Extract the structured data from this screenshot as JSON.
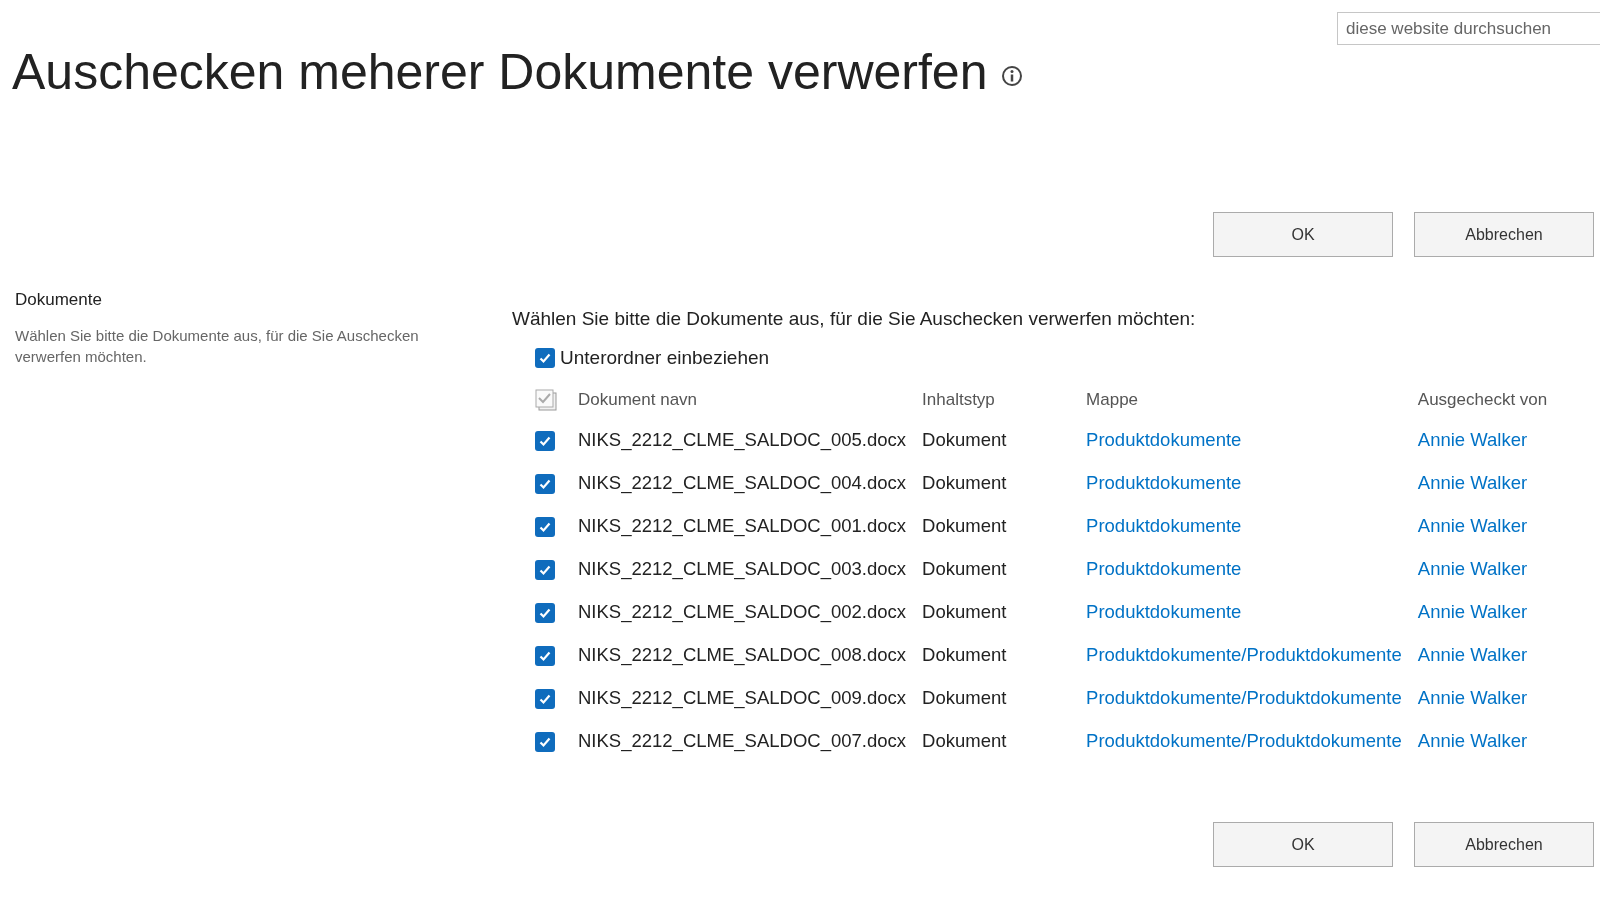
{
  "search": {
    "placeholder": "diese website durchsuchen"
  },
  "title": "Auschecken meherer Dokumente verwerfen",
  "top_buttons": [
    "OK",
    "Abbrechen"
  ],
  "section": {
    "label": "Dokumente",
    "description": "Wählen Sie bitte die Dokumente aus, für die Sie Auschecken verwerfen möchten."
  },
  "instruction": "Wählen Sie bitte die Dokumente aus, für die Sie Auschecken verwerfen möchten:",
  "include_subfolders": {
    "label": "Unterordner einbeziehen",
    "checked": true
  },
  "table": {
    "columns": [
      "Dokument navn",
      "Inhaltstyp",
      "Mappe",
      "Ausgecheckt von"
    ],
    "rows": [
      {
        "checked": true,
        "name": "NIKS_2212_CLME_SALDOC_005.docx",
        "type": "Dokument",
        "folder": "Produktdokumente",
        "user": "Annie Walker"
      },
      {
        "checked": true,
        "name": "NIKS_2212_CLME_SALDOC_004.docx",
        "type": "Dokument",
        "folder": "Produktdokumente",
        "user": "Annie Walker"
      },
      {
        "checked": true,
        "name": "NIKS_2212_CLME_SALDOC_001.docx",
        "type": "Dokument",
        "folder": "Produktdokumente",
        "user": "Annie Walker"
      },
      {
        "checked": true,
        "name": "NIKS_2212_CLME_SALDOC_003.docx",
        "type": "Dokument",
        "folder": "Produktdokumente",
        "user": "Annie Walker"
      },
      {
        "checked": true,
        "name": "NIKS_2212_CLME_SALDOC_002.docx",
        "type": "Dokument",
        "folder": "Produktdokumente",
        "user": "Annie Walker"
      },
      {
        "checked": true,
        "name": "NIKS_2212_CLME_SALDOC_008.docx",
        "type": "Dokument",
        "folder": "Produktdokumente/Produktdokumente",
        "user": "Annie Walker"
      },
      {
        "checked": true,
        "name": "NIKS_2212_CLME_SALDOC_009.docx",
        "type": "Dokument",
        "folder": "Produktdokumente/Produktdokumente",
        "user": "Annie Walker"
      },
      {
        "checked": true,
        "name": "NIKS_2212_CLME_SALDOC_007.docx",
        "type": "Dokument",
        "folder": "Produktdokumente/Produktdokumente",
        "user": "Annie Walker"
      }
    ]
  },
  "bottom_buttons": [
    "OK",
    "Abbrechen"
  ]
}
